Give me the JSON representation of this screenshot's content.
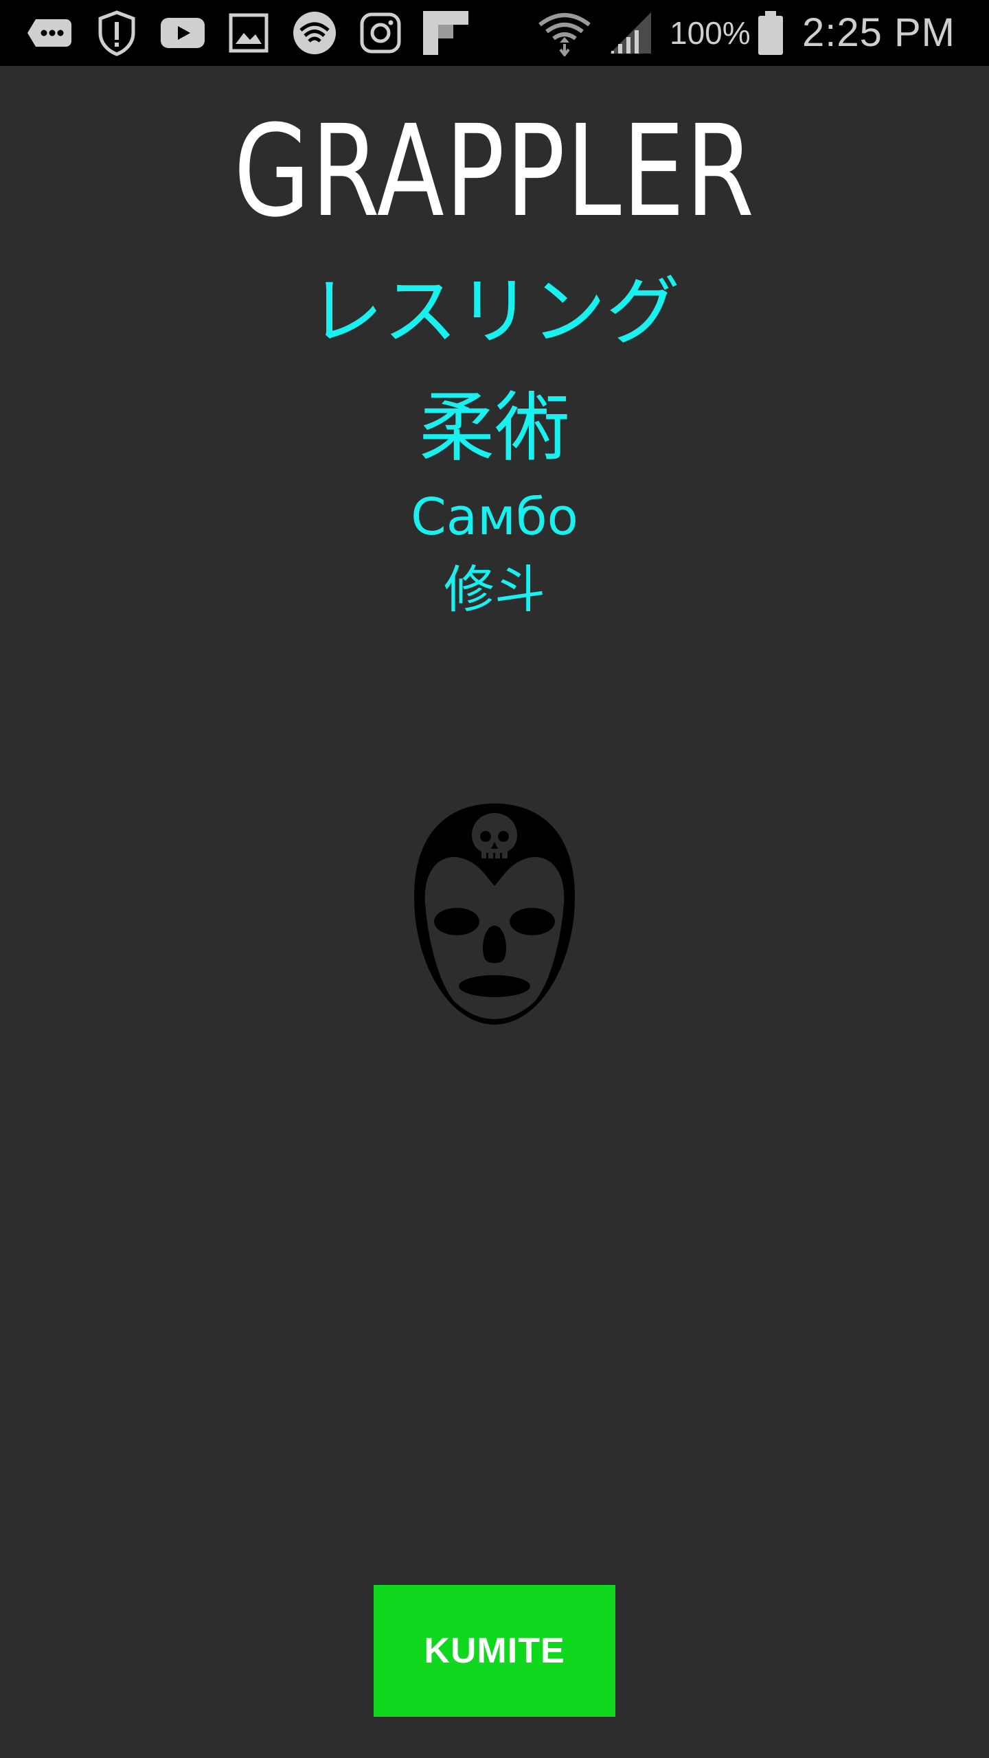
{
  "status_bar": {
    "icons": [
      "chat-bubble-icon",
      "shield-alert-icon",
      "youtube-icon",
      "gallery-icon",
      "wifi-app-icon",
      "instagram-icon",
      "flipboard-icon",
      "wifi-signal-icon",
      "cell-signal-icon",
      "battery-icon"
    ],
    "battery_percent": "100%",
    "time": "2:25 PM"
  },
  "app": {
    "title": "GRAPPLER",
    "subtitles": [
      "レスリング",
      "柔術",
      "Самбо",
      "修斗"
    ],
    "mask_icon": "luchador-mask-icon",
    "button_label": "KUMITE"
  },
  "colors": {
    "background": "#2d2d2d",
    "status_bar": "#000000",
    "title": "#ffffff",
    "subtitle": "#19f0f0",
    "button": "#0fd81f",
    "button_text": "#ffffff",
    "mask": "#000000"
  }
}
